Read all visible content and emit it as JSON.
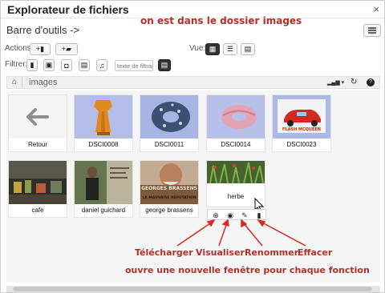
{
  "window": {
    "title": "Explorateur de fichiers",
    "close_glyph": "×"
  },
  "annotations": {
    "top": "on est dans le dossier images",
    "labels": [
      "Télécharger",
      "Visualiser",
      "Renommer",
      "Effacer"
    ],
    "bottom": "ouvre une nouvelle fenêtre pour chaque fonction",
    "color": "#b0302a"
  },
  "toolbar": {
    "title": "Barre d'outils ->",
    "actions_label": "Actions:",
    "action_buttons": [
      {
        "icon": "upload-file-icon",
        "glyph": "+▮"
      },
      {
        "icon": "new-folder-icon",
        "glyph": "+▰"
      }
    ],
    "view_label": "Vue:",
    "view_buttons": [
      {
        "icon": "grid-view-icon",
        "glyph": "▦",
        "active": true
      },
      {
        "icon": "list-view-icon",
        "glyph": "☰",
        "active": false
      },
      {
        "icon": "detail-view-icon",
        "glyph": "▤",
        "active": false
      }
    ],
    "filter_label": "Filtrer:",
    "filter_buttons": [
      {
        "icon": "document-filter-icon",
        "glyph": "▮"
      },
      {
        "icon": "image-filter-icon",
        "glyph": "▣"
      },
      {
        "icon": "archive-filter-icon",
        "glyph": "◘"
      },
      {
        "icon": "video-filter-icon",
        "glyph": "▤"
      },
      {
        "icon": "audio-filter-icon",
        "glyph": "♫"
      }
    ],
    "filter_placeholder": "texte de filtrage",
    "filter_clear_glyph": "▤"
  },
  "breadcrumb": {
    "home_glyph": "⌂",
    "path": "images",
    "tools": [
      {
        "icon": "sort-icon",
        "glyph": "▂▄▆ ▾"
      },
      {
        "icon": "refresh-icon",
        "glyph": "↻"
      },
      {
        "icon": "help-icon",
        "glyph": "?"
      }
    ]
  },
  "files": [
    {
      "name": "Retour",
      "kind": "back"
    },
    {
      "name": "DSCI0008",
      "kind": "image"
    },
    {
      "name": "DSCI0011",
      "kind": "image"
    },
    {
      "name": "DSCI0014",
      "kind": "image"
    },
    {
      "name": "DSCI0023",
      "kind": "image"
    },
    {
      "name": "cafe",
      "kind": "image"
    },
    {
      "name": "daniel guichard",
      "kind": "image"
    },
    {
      "name": "george brassens",
      "kind": "image"
    },
    {
      "name": "herbe",
      "kind": "image",
      "selected": true
    }
  ],
  "thumb_text": {
    "dsci0023": "FLASH MCQUEEN",
    "brassens_top": "GEORGES BRASSENS",
    "brassens_bottom": "LA MAUVAISE RÉPUTATION"
  },
  "file_actions": [
    {
      "icon": "download-icon",
      "glyph": "⊕"
    },
    {
      "icon": "view-eye-icon",
      "glyph": "◉"
    },
    {
      "icon": "rename-pencil-icon",
      "glyph": "✎"
    },
    {
      "icon": "delete-trash-icon",
      "glyph": "▮"
    }
  ]
}
